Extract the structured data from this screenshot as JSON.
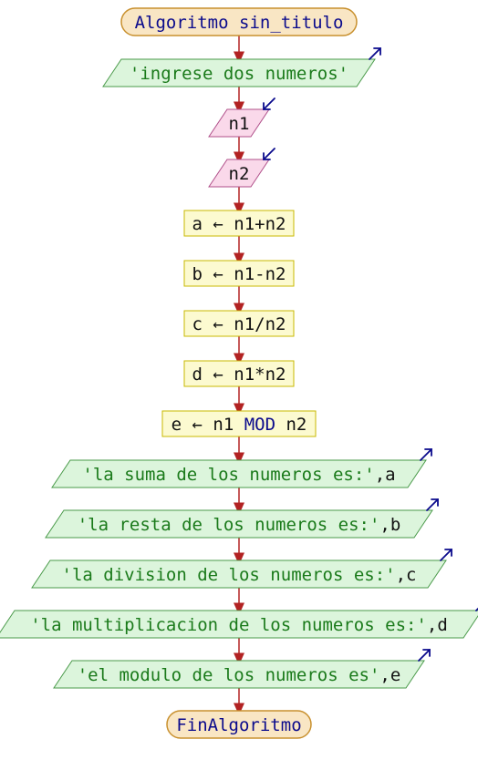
{
  "colors": {
    "connector": "#b22222",
    "terminator_fill": "#f9e6c4",
    "terminator_stroke": "#c8902e",
    "io_output_fill": "#dcf5dc",
    "io_output_stroke": "#4a9a4a",
    "io_input_fill": "#fad9ea",
    "io_input_stroke": "#b0508a",
    "process_fill": "#fcfad0",
    "process_stroke": "#c8b800",
    "keyword": "#0a0a8c",
    "string": "#1a7a1a",
    "default_text": "#111111",
    "io_arrow": "#0a0a8c"
  },
  "nodes": [
    {
      "id": "start",
      "type": "terminator",
      "parts": [
        {
          "t": "Algoritmo sin_titulo",
          "c": "keyword"
        }
      ]
    },
    {
      "id": "out1",
      "type": "output",
      "parts": [
        {
          "t": "'ingrese dos numeros'",
          "c": "string"
        }
      ]
    },
    {
      "id": "in1",
      "type": "input",
      "parts": [
        {
          "t": "n1",
          "c": "default"
        }
      ]
    },
    {
      "id": "in2",
      "type": "input",
      "parts": [
        {
          "t": "n2",
          "c": "default"
        }
      ]
    },
    {
      "id": "p1",
      "type": "process",
      "parts": [
        {
          "t": "a ← n1+n2",
          "c": "default"
        }
      ]
    },
    {
      "id": "p2",
      "type": "process",
      "parts": [
        {
          "t": "b ← n1-n2",
          "c": "default"
        }
      ]
    },
    {
      "id": "p3",
      "type": "process",
      "parts": [
        {
          "t": "c ← n1/n2",
          "c": "default"
        }
      ]
    },
    {
      "id": "p4",
      "type": "process",
      "parts": [
        {
          "t": "d ← n1*n2",
          "c": "default"
        }
      ]
    },
    {
      "id": "p5",
      "type": "process",
      "parts": [
        {
          "t": "e ← n1 ",
          "c": "default"
        },
        {
          "t": "MOD",
          "c": "keyword"
        },
        {
          "t": " n2",
          "c": "default"
        }
      ]
    },
    {
      "id": "out2",
      "type": "output",
      "parts": [
        {
          "t": "'la suma de los numeros es:'",
          "c": "string"
        },
        {
          "t": ",a",
          "c": "default"
        }
      ]
    },
    {
      "id": "out3",
      "type": "output",
      "parts": [
        {
          "t": "'la resta de los numeros es:'",
          "c": "string"
        },
        {
          "t": ",b",
          "c": "default"
        }
      ]
    },
    {
      "id": "out4",
      "type": "output",
      "parts": [
        {
          "t": "'la division de los numeros es:'",
          "c": "string"
        },
        {
          "t": ",c",
          "c": "default"
        }
      ]
    },
    {
      "id": "out5",
      "type": "output",
      "parts": [
        {
          "t": "'la multiplicacion de los numeros es:'",
          "c": "string"
        },
        {
          "t": ",d",
          "c": "default"
        }
      ]
    },
    {
      "id": "out6",
      "type": "output",
      "parts": [
        {
          "t": "'el modulo de los numeros es'",
          "c": "string"
        },
        {
          "t": ",e",
          "c": "default"
        }
      ]
    },
    {
      "id": "end",
      "type": "terminator",
      "parts": [
        {
          "t": "FinAlgoritmo",
          "c": "keyword"
        }
      ]
    }
  ]
}
